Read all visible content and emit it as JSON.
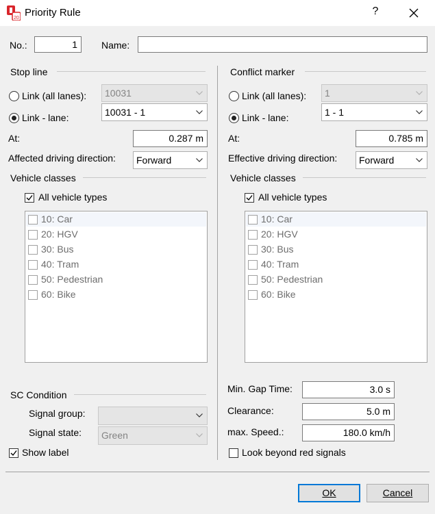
{
  "window": {
    "title": "Priority Rule",
    "help": "?"
  },
  "header": {
    "no_label": "No.:",
    "no_value": "1",
    "name_label": "Name:",
    "name_value": ""
  },
  "stop_line": {
    "group_title": "Stop line",
    "link_all_label": "Link (all lanes):",
    "link_all_value": "10031",
    "link_lane_label": "Link - lane:",
    "link_lane_value": "10031 - 1",
    "at_label": "At:",
    "at_value": "0.287 m",
    "direction_label": "Affected driving direction:",
    "direction_value": "Forward",
    "vehicle_classes_title": "Vehicle classes",
    "all_vehicle_types": "All vehicle types",
    "vehicle_list": [
      "10: Car",
      "20: HGV",
      "30: Bus",
      "40: Tram",
      "50: Pedestrian",
      "60: Bike"
    ]
  },
  "conflict_marker": {
    "group_title": "Conflict marker",
    "link_all_label": "Link (all lanes):",
    "link_all_value": "1",
    "link_lane_label": "Link - lane:",
    "link_lane_value": "1 - 1",
    "at_label": "At:",
    "at_value": "0.785 m",
    "direction_label": "Effective driving direction:",
    "direction_value": "Forward",
    "vehicle_classes_title": "Vehicle classes",
    "all_vehicle_types": "All vehicle types",
    "vehicle_list": [
      "10: Car",
      "20: HGV",
      "30: Bus",
      "40: Tram",
      "50: Pedestrian",
      "60: Bike"
    ]
  },
  "sc_condition": {
    "group_title": "SC Condition",
    "signal_group_label": "Signal group:",
    "signal_group_value": "",
    "signal_state_label": "Signal state:",
    "signal_state_value": "Green",
    "show_label": "Show label"
  },
  "gap": {
    "min_gap_label": "Min. Gap Time:",
    "min_gap_value": "3.0 s",
    "clearance_label": "Clearance:",
    "clearance_value": "5.0 m",
    "max_speed_label": "max. Speed.:",
    "max_speed_value": "180.0 km/h",
    "look_beyond_label": "Look beyond red signals"
  },
  "footer": {
    "ok_label": "OK",
    "cancel_label": "Cancel"
  },
  "colors": {
    "accent": "#0078d7",
    "app_icon": "#d9262c"
  }
}
